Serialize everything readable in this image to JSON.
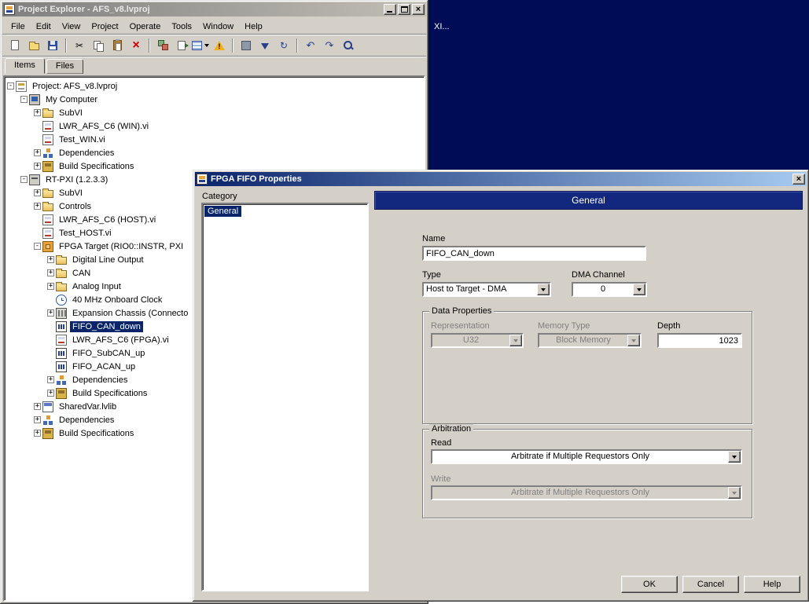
{
  "backdrop": {
    "text": "XI..."
  },
  "window": {
    "title": "Project Explorer - AFS_v8.lvproj",
    "menu": [
      "File",
      "Edit",
      "View",
      "Project",
      "Operate",
      "Tools",
      "Window",
      "Help"
    ],
    "toolbar_groups": [
      [
        {
          "name": "new-vi-icon"
        },
        {
          "name": "open-project-icon"
        },
        {
          "name": "save-all-icon"
        }
      ],
      [
        {
          "name": "cut-icon"
        },
        {
          "name": "copy-icon"
        },
        {
          "name": "paste-icon"
        },
        {
          "name": "delete-icon"
        }
      ],
      [
        {
          "name": "resolve-conflicts-icon"
        },
        {
          "name": "export-icon"
        },
        {
          "name": "items-view-icon",
          "dropdown": true
        },
        {
          "name": "warning-icon"
        }
      ],
      [
        {
          "name": "build-icon"
        },
        {
          "name": "deploy-icon"
        },
        {
          "name": "refresh-icon"
        }
      ],
      [
        {
          "name": "undo-icon"
        },
        {
          "name": "redo-icon"
        },
        {
          "name": "find-icon"
        }
      ]
    ],
    "tabs": [
      {
        "label": "Items",
        "active": true
      },
      {
        "label": "Files",
        "active": false
      }
    ],
    "tree": [
      {
        "label": "Project: AFS_v8.lvproj",
        "depth": 0,
        "toggle": "-",
        "icon": "project-icon",
        "selected": false
      },
      {
        "label": "My Computer",
        "depth": 1,
        "toggle": "-",
        "icon": "computer-icon",
        "selected": false
      },
      {
        "label": "SubVI",
        "depth": 2,
        "toggle": "+",
        "icon": "folder-icon",
        "selected": false
      },
      {
        "label": "LWR_AFS_C6 (WIN).vi",
        "depth": 2,
        "toggle": "",
        "icon": "vi-icon",
        "selected": false
      },
      {
        "label": "Test_WIN.vi",
        "depth": 2,
        "toggle": "",
        "icon": "vi-icon",
        "selected": false
      },
      {
        "label": "Dependencies",
        "depth": 2,
        "toggle": "+",
        "icon": "dependencies-icon",
        "selected": false
      },
      {
        "label": "Build Specifications",
        "depth": 2,
        "toggle": "+",
        "icon": "build-spec-icon",
        "selected": false
      },
      {
        "label": "RT-PXI (1.2.3.3)",
        "depth": 1,
        "toggle": "-",
        "icon": "rt-target-icon",
        "selected": false
      },
      {
        "label": "SubVI",
        "depth": 2,
        "toggle": "+",
        "icon": "folder-icon",
        "selected": false
      },
      {
        "label": "Controls",
        "depth": 2,
        "toggle": "+",
        "icon": "folder-icon",
        "selected": false
      },
      {
        "label": "LWR_AFS_C6 (HOST).vi",
        "depth": 2,
        "toggle": "",
        "icon": "vi-icon",
        "selected": false
      },
      {
        "label": "Test_HOST.vi",
        "depth": 2,
        "toggle": "",
        "icon": "vi-icon",
        "selected": false
      },
      {
        "label": "FPGA Target (RIO0::INSTR, PXI",
        "depth": 2,
        "toggle": "-",
        "icon": "fpga-target-icon",
        "selected": false
      },
      {
        "label": "Digital Line Output",
        "depth": 3,
        "toggle": "+",
        "icon": "folder-icon",
        "selected": false
      },
      {
        "label": "CAN",
        "depth": 3,
        "toggle": "+",
        "icon": "folder-icon",
        "selected": false
      },
      {
        "label": "Analog Input",
        "depth": 3,
        "toggle": "+",
        "icon": "folder-icon",
        "selected": false
      },
      {
        "label": "40 MHz Onboard Clock",
        "depth": 3,
        "toggle": "",
        "icon": "clock-icon",
        "selected": false
      },
      {
        "label": "Expansion Chassis (Connecto",
        "depth": 3,
        "toggle": "+",
        "icon": "chassis-icon",
        "selected": false
      },
      {
        "label": "FIFO_CAN_down",
        "depth": 3,
        "toggle": "",
        "icon": "fifo-icon",
        "selected": true
      },
      {
        "label": "LWR_AFS_C6 (FPGA).vi",
        "depth": 3,
        "toggle": "",
        "icon": "vi-icon",
        "selected": false
      },
      {
        "label": "FIFO_SubCAN_up",
        "depth": 3,
        "toggle": "",
        "icon": "fifo-icon",
        "selected": false
      },
      {
        "label": "FIFO_ACAN_up",
        "depth": 3,
        "toggle": "",
        "icon": "fifo-icon",
        "selected": false
      },
      {
        "label": "Dependencies",
        "depth": 3,
        "toggle": "+",
        "icon": "dependencies-icon",
        "selected": false
      },
      {
        "label": "Build Specifications",
        "depth": 3,
        "toggle": "+",
        "icon": "build-spec-icon",
        "selected": false
      },
      {
        "label": "SharedVar.lvlib",
        "depth": 2,
        "toggle": "+",
        "icon": "library-icon",
        "selected": false
      },
      {
        "label": "Dependencies",
        "depth": 2,
        "toggle": "+",
        "icon": "dependencies-icon",
        "selected": false
      },
      {
        "label": "Build Specifications",
        "depth": 2,
        "toggle": "+",
        "icon": "build-spec-icon",
        "selected": false
      }
    ]
  },
  "dialog": {
    "title": "FPGA FIFO Properties",
    "category": {
      "label": "Category",
      "items": [
        {
          "label": "General",
          "selected": true
        }
      ]
    },
    "header": "General",
    "name": {
      "label": "Name",
      "value": "FIFO_CAN_down"
    },
    "type": {
      "label": "Type",
      "value": "Host to Target - DMA"
    },
    "dma": {
      "label": "DMA Channel",
      "value": "0"
    },
    "data_properties": {
      "label": "Data Properties",
      "representation": {
        "label": "Representation",
        "value": "U32"
      },
      "memory_type": {
        "label": "Memory Type",
        "value": "Block Memory"
      },
      "depth": {
        "label": "Depth",
        "value": "1023"
      }
    },
    "arbitration": {
      "label": "Arbitration",
      "read": {
        "label": "Read",
        "value": "Arbitrate if Multiple Requestors Only"
      },
      "write": {
        "label": "Write",
        "value": "Arbitrate if Multiple Requestors Only"
      }
    },
    "buttons": [
      {
        "label": "OK"
      },
      {
        "label": "Cancel"
      },
      {
        "label": "Help"
      }
    ]
  }
}
